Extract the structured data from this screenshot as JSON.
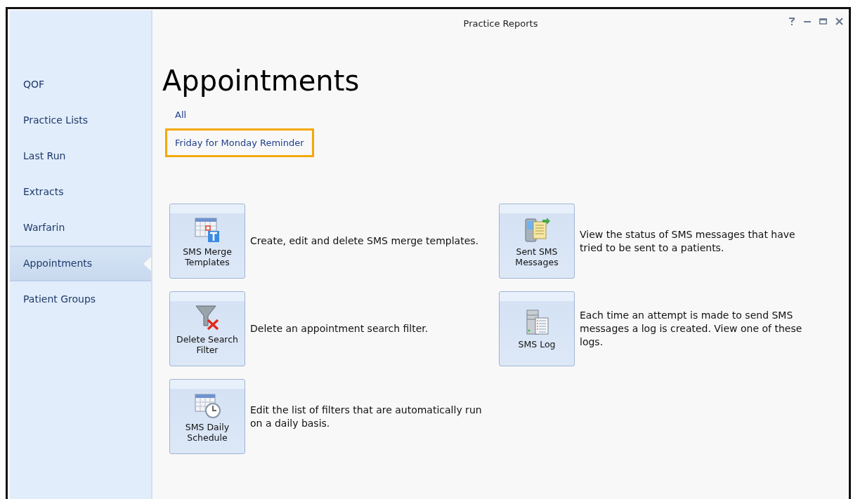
{
  "window": {
    "title": "Practice Reports"
  },
  "sidebar": {
    "items": [
      {
        "label": "QOF",
        "selected": false
      },
      {
        "label": "Practice Lists",
        "selected": false
      },
      {
        "label": "Last Run",
        "selected": false
      },
      {
        "label": "Extracts",
        "selected": false
      },
      {
        "label": "Warfarin",
        "selected": false
      },
      {
        "label": "Appointments",
        "selected": true
      },
      {
        "label": "Patient Groups",
        "selected": false
      }
    ]
  },
  "heading": "Appointments",
  "links": [
    {
      "label": "All",
      "highlighted": false
    },
    {
      "label": "Friday for Monday Reminder",
      "highlighted": true
    }
  ],
  "tiles_left": [
    {
      "label": "SMS Merge Templates",
      "description": "Create, edit and delete SMS merge templates."
    },
    {
      "label": "Delete Search Filter",
      "description": "Delete an appointment search filter."
    },
    {
      "label": "SMS Daily Schedule",
      "description": "Edit the list of filters that are automatically run on a daily basis."
    }
  ],
  "tiles_right": [
    {
      "label": "Sent SMS Messages",
      "description": "View the status of SMS messages that have tried to be sent to a patients."
    },
    {
      "label": "SMS Log",
      "description": "Each time an attempt is made to send SMS messages a log is created. View one of these logs."
    }
  ]
}
